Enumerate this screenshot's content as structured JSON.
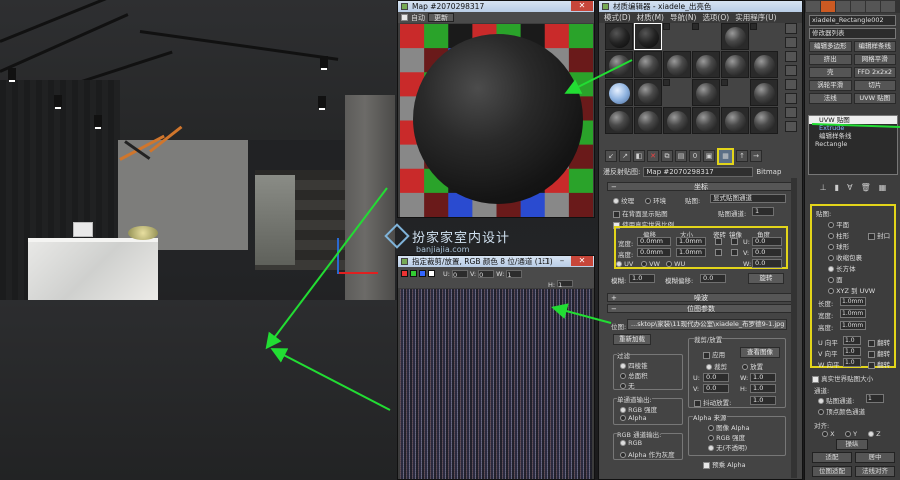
{
  "map_preview": {
    "title": "Map #2070298317",
    "auto_label": "自动",
    "update_label": "更新"
  },
  "watermark": {
    "text": "扮家家室内设计",
    "sub": "banjiajia.com"
  },
  "bitmap_window": {
    "title": "指定裁剪/放置, RGB 颜色 8 位/通道 (1:1)",
    "u_label": "U:",
    "u_value": "0",
    "v_label": "V:",
    "v_value": "0",
    "w_label": "W:",
    "w_value": "1",
    "h_label": "H:",
    "h_value": "1"
  },
  "material_editor": {
    "title": "材质编辑器 - xiadele_出亮色",
    "menu": [
      "模式(D)",
      "材质(M)",
      "导航(N)",
      "选项(O)",
      "实用程序(U)"
    ],
    "name_label": "漫反射贴图:",
    "map_name": "Map #2070298317",
    "map_type": "Bitmap",
    "coords": {
      "rollout": "坐标",
      "texture_label": "纹理",
      "env_label": "环境",
      "mapping_label": "贴图:",
      "mapping_value": "显式贴图通道",
      "show_back_label": "在背面显示贴图",
      "channel_label": "贴图通道:",
      "channel_value": "1",
      "real_world_label": "使用真实世界比例",
      "offset_header": "偏移",
      "size_header": "大小",
      "tile_header": "瓷砖",
      "mirror_header": "镜像",
      "angle_header": "角度",
      "width_label": "宽度:",
      "height_label": "高度:",
      "width_offset": "0.0mm",
      "height_offset": "0.0mm",
      "width_size": "1.0mm",
      "height_size": "1.0mm",
      "u_angle_label": "U:",
      "v_angle_label": "V:",
      "w_angle_label": "W:",
      "u_angle": "0.0",
      "v_angle": "0.0",
      "w_angle": "0.0",
      "uv_label": "UV",
      "vw_label": "VW",
      "wu_label": "WU",
      "blur_label": "模糊:",
      "blur_value": "1.0",
      "blur_offset_label": "模糊偏移:",
      "blur_offset_value": "0.0",
      "rotate_button": "旋转"
    },
    "noise_rollout": "噪波",
    "bitmap_params": {
      "rollout": "位图参数",
      "bitmap_label": "位图:",
      "path": "...sktop\\家装\\11现代办公室\\xiadele_布罗德9-1.jpg",
      "reload_button": "重新加载",
      "crop_group": "裁剪/放置",
      "apply_label": "应用",
      "view_button": "查看图像",
      "crop_label": "裁剪",
      "place_label": "放置",
      "u_label": "U:",
      "v_label": "V:",
      "w_label": "W:",
      "h_label": "H:",
      "u_value": "0.0",
      "v_value": "0.0",
      "w_value": "1.0",
      "h_value": "1.0",
      "jitter_label": "抖动放置:",
      "jitter_value": "1.0",
      "filter_group": "过滤",
      "filter_options": [
        "四棱锥",
        "总面积",
        "无"
      ],
      "mono_group": "单通道输出:",
      "mono_options": [
        "RGB 强度",
        "Alpha"
      ],
      "rgb_group": "RGB 通道输出:",
      "rgb_options": [
        "RGB",
        "Alpha 作为灰度"
      ],
      "alpha_group": "Alpha 来源",
      "alpha_options": [
        "图像 Alpha",
        "RGB 强度",
        "无(不透明)"
      ],
      "premult_label": "预乘 Alpha"
    }
  },
  "command_panel": {
    "object_name": "xiadele_Rectangle002",
    "modifier_list": "修改器列表",
    "buttons": [
      "编辑多边形",
      "编辑样条线",
      "挤出",
      "网格平滑",
      "壳",
      "FFD 2x2x2",
      "涡轮平滑",
      "切片",
      "法线",
      "UVW 贴图"
    ],
    "stack": [
      "UVW 贴图",
      "Extrude",
      "编辑样条线",
      "Rectangle"
    ],
    "mapping": {
      "title": "贴图:",
      "options": [
        "平面",
        "柱形",
        "球形",
        "收缩包裹",
        "长方体",
        "面",
        "XYZ 到 UVW"
      ],
      "cap_label": "封口",
      "length_label": "长度:",
      "width_label": "宽度:",
      "height_label": "高度:",
      "length_value": "1.0mm",
      "width_value": "1.0mm",
      "height_value": "1.0mm",
      "u_tile_label": "U 向平",
      "v_tile_label": "V 向平",
      "w_tile_label": "W 向平",
      "u_tile": "1.0",
      "v_tile": "1.0",
      "w_tile": "1.0",
      "flip_label": "翻转"
    },
    "real_world_label": "真实世界贴图大小",
    "channel_title": "通道:",
    "map_channel_label": "贴图通道:",
    "map_channel_value": "1",
    "vertex_color_label": "顶点颜色通道",
    "align_title": "对齐:",
    "x_label": "X",
    "y_label": "Y",
    "z_label": "Z",
    "manipulate_button": "操纵",
    "fit_button": "适配",
    "center_button": "居中",
    "bitmap_fit_button": "位图适配",
    "normal_align_button": "法线对齐"
  }
}
